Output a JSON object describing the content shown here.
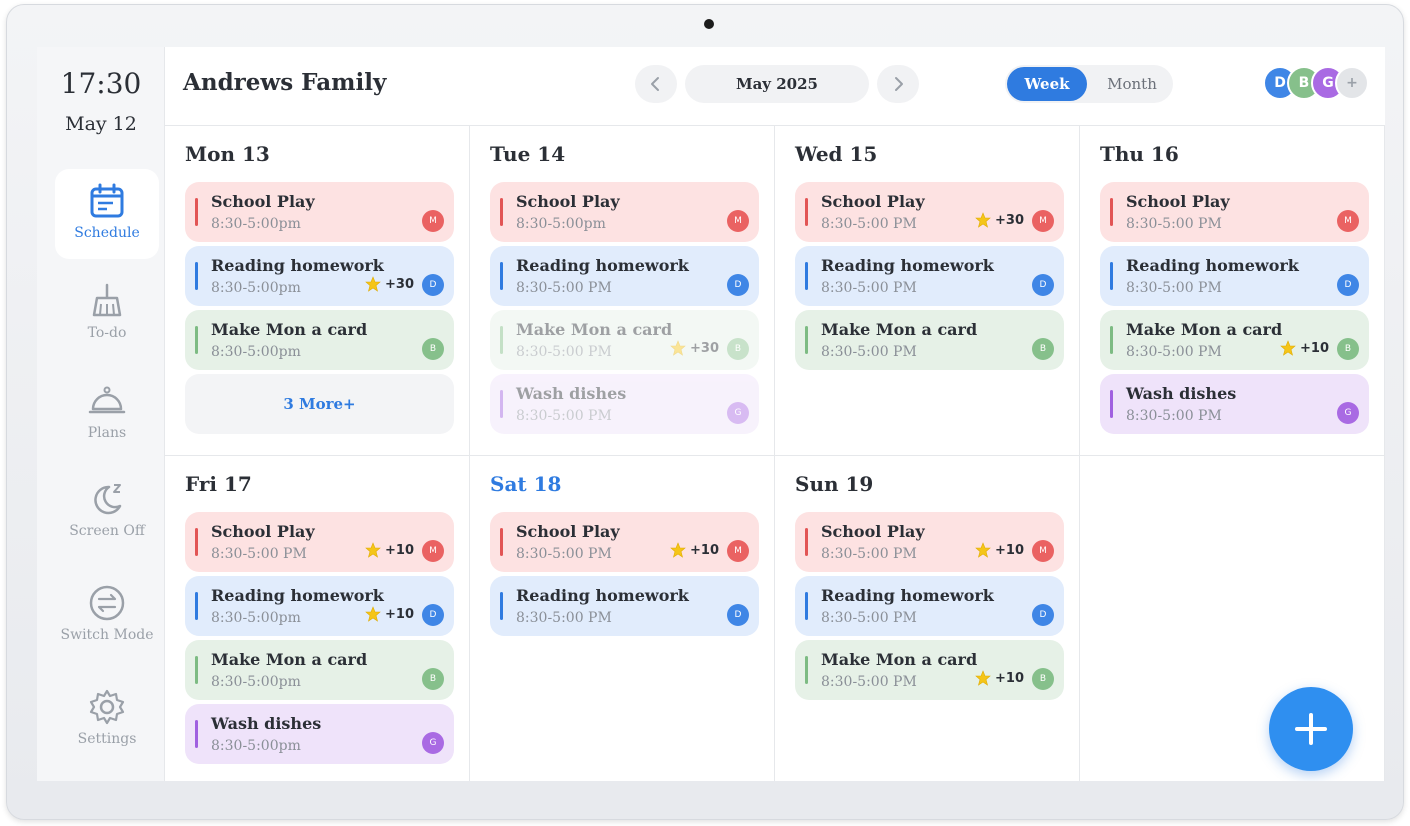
{
  "clock": {
    "time": "17:30",
    "date": "May 12"
  },
  "nav": [
    {
      "label": "Schedule",
      "icon": "calendar-icon",
      "active": true
    },
    {
      "label": "To-do",
      "icon": "broom-icon",
      "active": false
    },
    {
      "label": "Plans",
      "icon": "cloche-icon",
      "active": false
    },
    {
      "label": "Screen Off",
      "icon": "moon-icon",
      "active": false
    },
    {
      "label": "Switch Mode",
      "icon": "switch-icon",
      "active": false
    },
    {
      "label": "Settings",
      "icon": "gear-icon",
      "active": false
    }
  ],
  "header": {
    "title": "Andrews Family",
    "month": "May 2025",
    "view_week": "Week",
    "view_month": "Month",
    "avatars": [
      {
        "letter": "D",
        "color": "#3f86e6"
      },
      {
        "letter": "B",
        "color": "#86c08b"
      },
      {
        "letter": "G",
        "color": "#a96ae3"
      },
      {
        "letter": "+",
        "color": "#e3e5e8"
      }
    ]
  },
  "colors": {
    "accent": "#2f7be0",
    "red": "#ea6262",
    "blue": "#3f86e6",
    "green": "#86c08b",
    "purple": "#a96ae3"
  },
  "days": [
    {
      "label": "Mon 13",
      "today": false,
      "events": [
        {
          "title": "School Play",
          "time": "8:30-5:00pm",
          "color": "red",
          "initial": "M",
          "points": ""
        },
        {
          "title": "Reading homework",
          "time": "8:30-5:00pm",
          "color": "blue",
          "initial": "D",
          "points": "+30"
        },
        {
          "title": "Make Mon a card",
          "time": "8:30-5:00pm",
          "color": "green",
          "initial": "B",
          "points": ""
        }
      ],
      "more": "3 More+"
    },
    {
      "label": "Tue 14",
      "today": false,
      "events": [
        {
          "title": "School Play",
          "time": "8:30-5:00pm",
          "color": "red",
          "initial": "M",
          "points": ""
        },
        {
          "title": "Reading homework",
          "time": "8:30-5:00 PM",
          "color": "blue",
          "initial": "D",
          "points": ""
        },
        {
          "title": "Make Mon a card",
          "time": "8:30-5:00 PM",
          "color": "green",
          "initial": "B",
          "points": "+30",
          "faded": true
        },
        {
          "title": "Wash dishes",
          "time": "8:30-5:00 PM",
          "color": "purple",
          "initial": "G",
          "points": "",
          "faded": true
        }
      ]
    },
    {
      "label": "Wed 15",
      "today": false,
      "events": [
        {
          "title": "School Play",
          "time": "8:30-5:00 PM",
          "color": "red",
          "initial": "M",
          "points": "+30"
        },
        {
          "title": "Reading homework",
          "time": "8:30-5:00 PM",
          "color": "blue",
          "initial": "D",
          "points": ""
        },
        {
          "title": "Make Mon a card",
          "time": "8:30-5:00 PM",
          "color": "green",
          "initial": "B",
          "points": ""
        }
      ]
    },
    {
      "label": "Thu 16",
      "today": false,
      "events": [
        {
          "title": "School Play",
          "time": "8:30-5:00 PM",
          "color": "red",
          "initial": "M",
          "points": ""
        },
        {
          "title": "Reading homework",
          "time": "8:30-5:00 PM",
          "color": "blue",
          "initial": "D",
          "points": ""
        },
        {
          "title": "Make Mon a card",
          "time": "8:30-5:00 PM",
          "color": "green",
          "initial": "B",
          "points": "+10"
        },
        {
          "title": "Wash dishes",
          "time": "8:30-5:00 PM",
          "color": "purple",
          "initial": "G",
          "points": ""
        }
      ]
    },
    {
      "label": "Fri 17",
      "today": false,
      "events": [
        {
          "title": "School Play",
          "time": "8:30-5:00 PM",
          "color": "red",
          "initial": "M",
          "points": "+10"
        },
        {
          "title": "Reading homework",
          "time": "8:30-5:00pm",
          "color": "blue",
          "initial": "D",
          "points": "+10"
        },
        {
          "title": "Make Mon a card",
          "time": "8:30-5:00pm",
          "color": "green",
          "initial": "B",
          "points": ""
        },
        {
          "title": "Wash dishes",
          "time": "8:30-5:00pm",
          "color": "purple",
          "initial": "G",
          "points": ""
        }
      ]
    },
    {
      "label": "Sat 18",
      "today": true,
      "events": [
        {
          "title": "School Play",
          "time": "8:30-5:00 PM",
          "color": "red",
          "initial": "M",
          "points": "+10"
        },
        {
          "title": "Reading homework",
          "time": "8:30-5:00 PM",
          "color": "blue",
          "initial": "D",
          "points": ""
        }
      ]
    },
    {
      "label": "Sun 19",
      "today": false,
      "events": [
        {
          "title": "School Play",
          "time": "8:30-5:00 PM",
          "color": "red",
          "initial": "M",
          "points": "+10"
        },
        {
          "title": "Reading homework",
          "time": "8:30-5:00 PM",
          "color": "blue",
          "initial": "D",
          "points": ""
        },
        {
          "title": "Make Mon a card",
          "time": "8:30-5:00 PM",
          "color": "green",
          "initial": "B",
          "points": "+10"
        }
      ]
    }
  ]
}
